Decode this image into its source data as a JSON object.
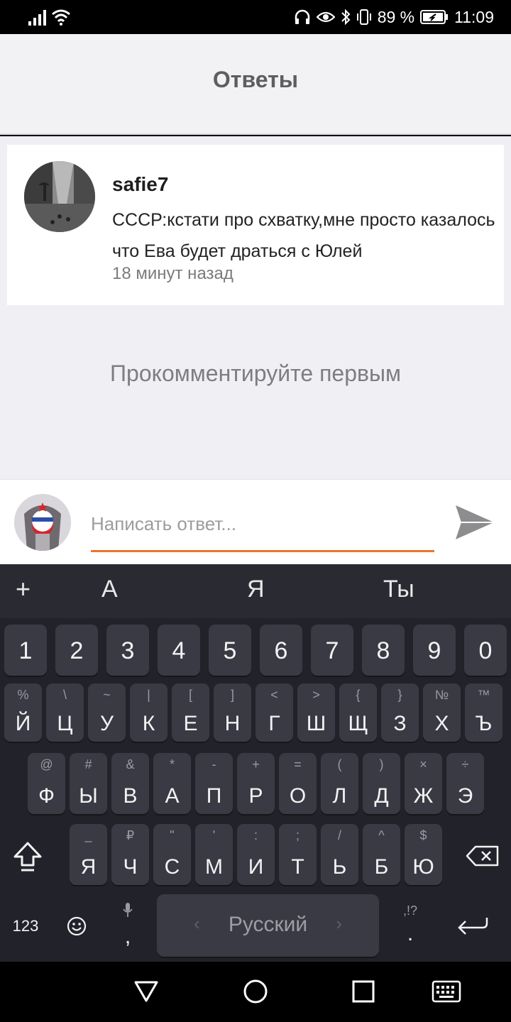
{
  "status_bar": {
    "battery_percent": "89 %",
    "time": "11:09"
  },
  "header": {
    "title": "Ответы"
  },
  "comment": {
    "author": "safie7",
    "text": "СССР:кстати про схватку,мне просто казалось что Ева будет драться с Юлей",
    "time": "18 минут назад"
  },
  "empty_message": "Прокомментируйте первым",
  "reply": {
    "placeholder": "Написать ответ...",
    "accent_color": "#e8772e"
  },
  "keyboard": {
    "suggestions": [
      "А",
      "Я",
      "Ты"
    ],
    "plus": "+",
    "number_row": [
      "1",
      "2",
      "3",
      "4",
      "5",
      "6",
      "7",
      "8",
      "9",
      "0"
    ],
    "row1": [
      {
        "main": "Й",
        "sub": "%"
      },
      {
        "main": "Ц",
        "sub": "\\"
      },
      {
        "main": "У",
        "sub": "~"
      },
      {
        "main": "К",
        "sub": "|"
      },
      {
        "main": "Е",
        "sub": "["
      },
      {
        "main": "Н",
        "sub": "]"
      },
      {
        "main": "Г",
        "sub": "<"
      },
      {
        "main": "Ш",
        "sub": ">"
      },
      {
        "main": "Щ",
        "sub": "{"
      },
      {
        "main": "З",
        "sub": "}"
      },
      {
        "main": "Х",
        "sub": "№"
      },
      {
        "main": "Ъ",
        "sub": "™"
      }
    ],
    "row2": [
      {
        "main": "Ф",
        "sub": "@"
      },
      {
        "main": "Ы",
        "sub": "#"
      },
      {
        "main": "В",
        "sub": "&"
      },
      {
        "main": "А",
        "sub": "*"
      },
      {
        "main": "П",
        "sub": "-"
      },
      {
        "main": "Р",
        "sub": "+"
      },
      {
        "main": "О",
        "sub": "="
      },
      {
        "main": "Л",
        "sub": "("
      },
      {
        "main": "Д",
        "sub": ")"
      },
      {
        "main": "Ж",
        "sub": "×"
      },
      {
        "main": "Э",
        "sub": "÷"
      }
    ],
    "row3": [
      {
        "main": "Я",
        "sub": "_"
      },
      {
        "main": "Ч",
        "sub": "₽"
      },
      {
        "main": "С",
        "sub": "\""
      },
      {
        "main": "М",
        "sub": "'"
      },
      {
        "main": "И",
        "sub": ":"
      },
      {
        "main": "Т",
        "sub": ";"
      },
      {
        "main": "Ь",
        "sub": "/"
      },
      {
        "main": "Б",
        "sub": "^"
      },
      {
        "main": "Ю",
        "sub": "$"
      }
    ],
    "numbers_label": "123",
    "comma": ",",
    "period": ".",
    "punct_hint": ",!?",
    "space_label": "Русский",
    "key_color": "#3a3a44"
  }
}
